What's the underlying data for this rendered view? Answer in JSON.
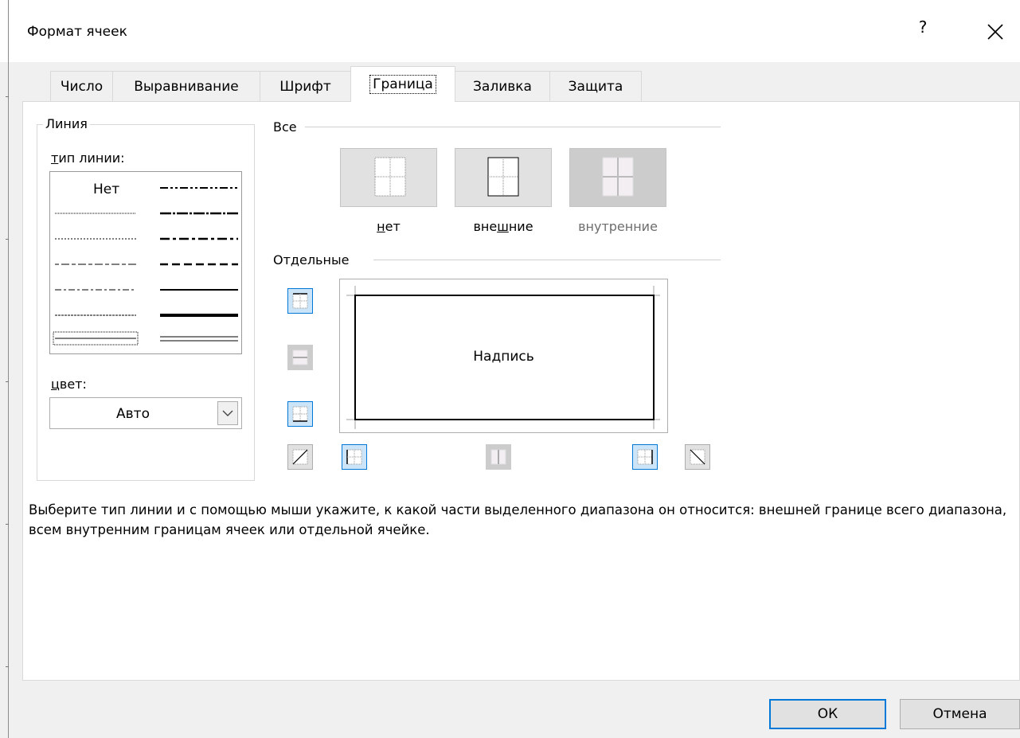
{
  "window": {
    "title": "Формат ячеек",
    "help_glyph": "?",
    "close_icon": "close-icon"
  },
  "tabs": [
    {
      "label": "Число"
    },
    {
      "label": "Выравнивание"
    },
    {
      "label": "Шрифт"
    },
    {
      "label": "Граница",
      "active": true
    },
    {
      "label": "Заливка"
    },
    {
      "label": "Защита"
    }
  ],
  "line_group": {
    "title": "Линия",
    "style_label_ul": "т",
    "style_label_rest": "ип линии:",
    "none_label": "Нет",
    "color_label_ul": "ц",
    "color_label_rest": "вет:",
    "color_value": "Авто"
  },
  "presets": {
    "title": "Все",
    "none_ul": "н",
    "none_rest": "ет",
    "outline_a": "вне",
    "outline_ul": "ш",
    "outline_b": "ние",
    "inside": "внутренние"
  },
  "individual": {
    "title": "Отдельные",
    "preview_text": "Надпись"
  },
  "description": "Выберите тип линии и с помощью мыши укажите, к какой части выделенного диапазона он относится: внешней границе всего диапазона, всем внутренним границам ячеек или отдельной ячейке.",
  "buttons": {
    "ok": "ОК",
    "cancel": "Отмена"
  },
  "colors": {
    "accent": "#0078d7",
    "selected_fill": "#cce4f7",
    "disabled_text": "#6d6d6d"
  }
}
